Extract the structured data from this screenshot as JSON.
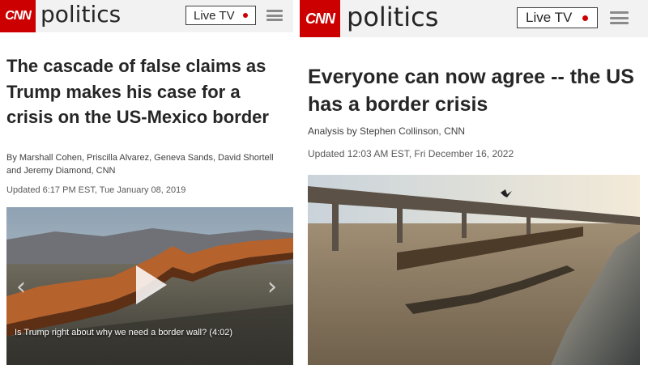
{
  "left": {
    "brand": "CNN",
    "section": "politics",
    "live_label": "Live TV",
    "headline": "The cascade of false claims as Trump makes his case for a crisis on the US-Mexico border",
    "byline": "By Marshall Cohen, Priscilla Alvarez, Geneva Sands, David Shortell and Jeremy Diamond, CNN",
    "updated": "Updated 6:17 PM EST, Tue January 08, 2019",
    "video_caption": "Is Trump right about why we need a border wall? (4:02)"
  },
  "right": {
    "brand": "CNN",
    "section": "politics",
    "live_label": "Live TV",
    "headline": "Everyone can now agree -- the US has a border crisis",
    "byline": "Analysis by Stephen Collinson, CNN",
    "updated": "Updated 12:03 AM EST, Fri December 16, 2022"
  },
  "colors": {
    "brand_red": "#cc0000",
    "header_bg": "#f2f2f2",
    "text_dark": "#262626"
  },
  "icons": [
    "play-icon",
    "menu-icon",
    "live-dot-icon",
    "chevron-left-icon",
    "chevron-right-icon"
  ]
}
